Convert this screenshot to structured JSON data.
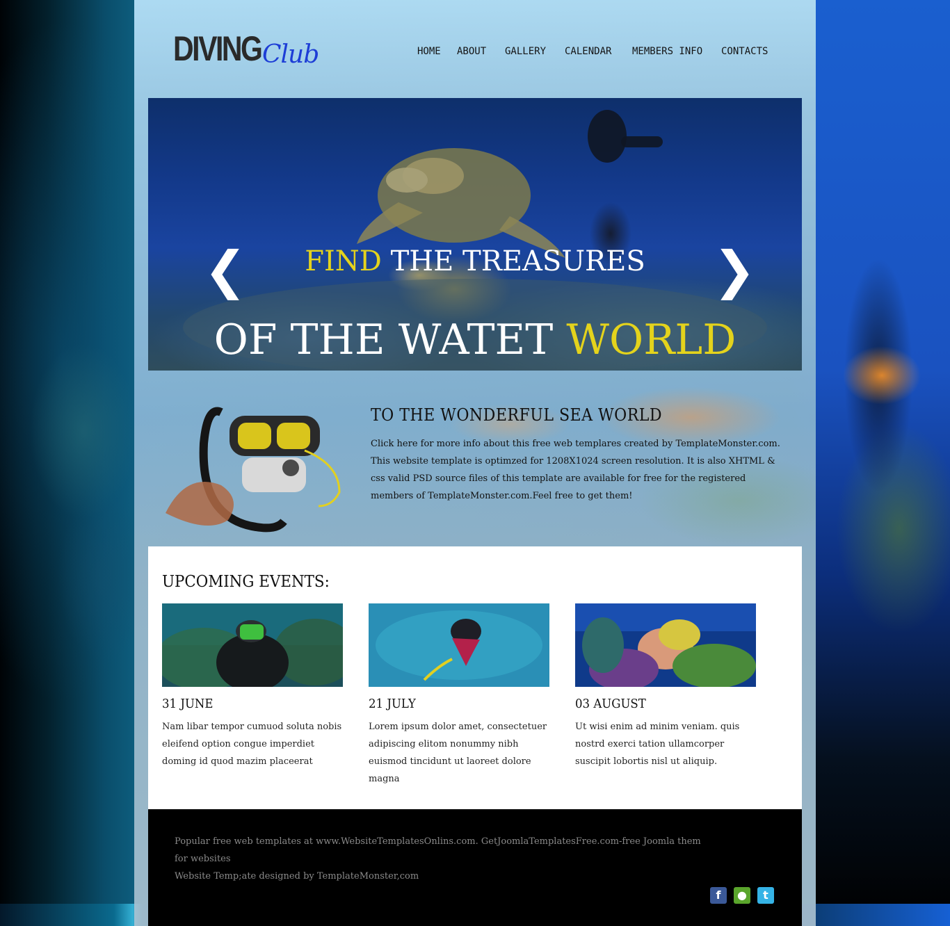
{
  "logo": {
    "main": "DIVING",
    "sub": "Club"
  },
  "nav": {
    "items": [
      {
        "label": "HOME"
      },
      {
        "label": "ABOUT"
      },
      {
        "label": "GALLERY"
      },
      {
        "label": "CALENDAR"
      },
      {
        "label": "MEMBERS INFO"
      },
      {
        "label": "CONTACTS"
      }
    ]
  },
  "slider": {
    "line1_highlight": "FIND",
    "line1_rest": " THE TREASURES",
    "line2_rest": "OF THE WATET ",
    "line2_highlight": "WORLD",
    "prev": "❮",
    "next": "❯"
  },
  "intro": {
    "title": "TO THE WONDERFUL SEA WORLD",
    "text": "Click here for more info about this free web templares created by TemplateMonster.com. This website template is optimzed for 1208X1024 screen resolution. It is also XHTML & css valid PSD source files of this template are available for free for the registered members of TemplateMonster.com.Feel free to get them!"
  },
  "events": {
    "title": "UPCOMING EVENTS:",
    "items": [
      {
        "date": "31 JUNE",
        "text": "Nam libar tempor cumuod soluta nobis eleifend option congue imperdiet doming id quod mazim placeerat"
      },
      {
        "date": "21 JULY",
        "text": "Lorem ipsum dolor amet, consectetuer adipiscing elitom nonummy nibh euismod tincidunt ut laoreet dolore magna"
      },
      {
        "date": "03 AUGUST",
        "text": "Ut wisi enim ad minim veniam. quis nostrd exerci tation ullamcorper suscipit lobortis nisl ut aliquip."
      }
    ]
  },
  "footer": {
    "line1": "Popular free web templates at www.WebsiteTemplatesOnlins.com. GetJoomlaTemplatesFree.com-free Joomla them for websites",
    "line2": "Website Temp;ate designed by TemplateMonster,com"
  },
  "social": [
    {
      "name": "facebook-icon",
      "glyph": "f",
      "color": "#3b5998"
    },
    {
      "name": "chat-icon",
      "glyph": "●",
      "color": "#5aa52c"
    },
    {
      "name": "twitter-icon",
      "glyph": "t",
      "color": "#35b3e6"
    }
  ],
  "colors": {
    "highlight": "#e4d31c",
    "logo_sub": "#1d3dd6"
  }
}
